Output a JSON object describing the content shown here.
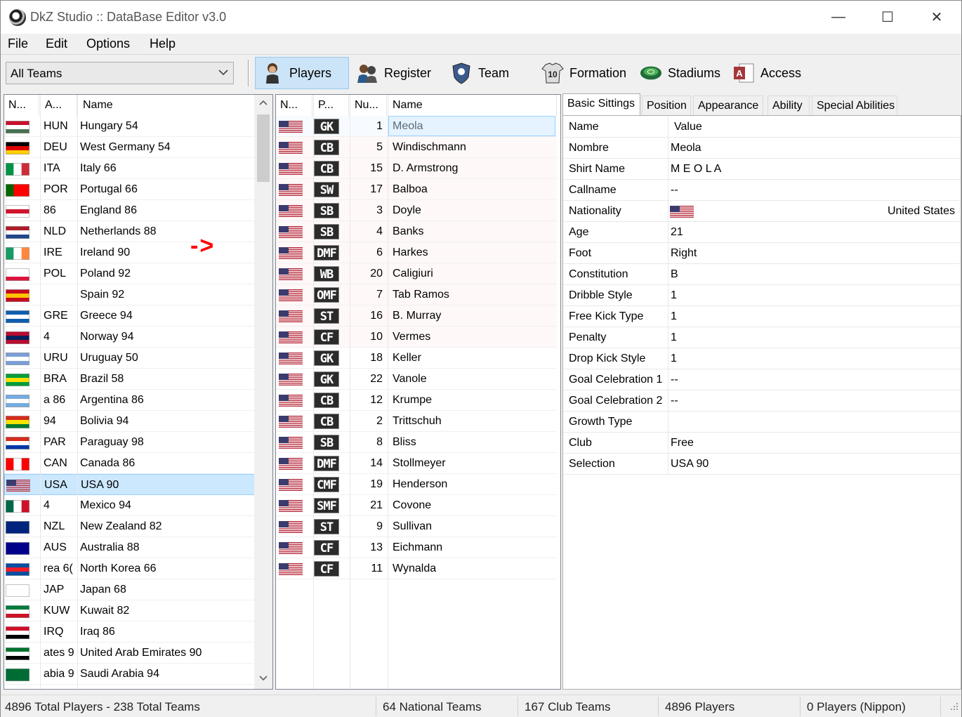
{
  "window": {
    "title": "DkZ Studio :: DataBase Editor v3.0",
    "minimize": "—",
    "maximize": "☐",
    "close": "✕"
  },
  "menu": [
    {
      "label": "File"
    },
    {
      "label": "Edit"
    },
    {
      "label": "Options"
    },
    {
      "label": "Help"
    }
  ],
  "toolbar": {
    "team_filter": "All Teams",
    "buttons": [
      {
        "label": "Players",
        "active": true
      },
      {
        "label": "Register"
      },
      {
        "label": "Team"
      },
      {
        "label": "Formation"
      },
      {
        "label": "Stadiums"
      },
      {
        "label": "Access"
      }
    ]
  },
  "teams": {
    "headers": [
      "N...",
      "A...",
      "Name"
    ],
    "selected_index": 17,
    "rows": [
      {
        "abbr": "HUN",
        "name": "Hungary 54",
        "flag": [
          "#c8102e",
          "#fff",
          "#477050"
        ]
      },
      {
        "abbr": "DEU",
        "name": "West Germany 54",
        "flag": [
          "#000",
          "#dd0000",
          "#ffce00"
        ]
      },
      {
        "abbr": "ITA",
        "name": "Italy 66",
        "flag": [
          "#009246",
          "#fff",
          "#ce2b37"
        ],
        "vertical": true
      },
      {
        "abbr": "POR",
        "name": "Portugal 66",
        "flag": [
          "#006600",
          "#ff0000",
          "#ff0000"
        ],
        "vertical": true
      },
      {
        "abbr": "86",
        "name": "England 86",
        "flag": [
          "#fff",
          "#cf142b",
          "#fff"
        ]
      },
      {
        "abbr": "NLD",
        "name": "Netherlands 88",
        "flag": [
          "#ae1c28",
          "#fff",
          "#21468b"
        ]
      },
      {
        "abbr": "IRE",
        "name": "Ireland 90",
        "flag": [
          "#169b62",
          "#fff",
          "#ff883e"
        ],
        "vertical": true
      },
      {
        "abbr": "POL",
        "name": "Poland 92",
        "flag": [
          "#fff",
          "#fff",
          "#dc143c"
        ]
      },
      {
        "abbr": "",
        "name": "Spain 92",
        "flag": [
          "#c60b1e",
          "#ffc400",
          "#c60b1e"
        ]
      },
      {
        "abbr": "GRE",
        "name": "Greece 94",
        "flag": [
          "#0d5eaf",
          "#fff",
          "#0d5eaf"
        ]
      },
      {
        "abbr": "4",
        "name": "Norway 94",
        "flag": [
          "#ba0c2f",
          "#00205b",
          "#ba0c2f"
        ]
      },
      {
        "abbr": "URU",
        "name": "Uruguay 50",
        "flag": [
          "#7b9fd6",
          "#fff",
          "#7b9fd6"
        ]
      },
      {
        "abbr": "BRA",
        "name": "Brazil 58",
        "flag": [
          "#009c3b",
          "#ffdf00",
          "#009c3b"
        ]
      },
      {
        "abbr": "a 86",
        "name": "Argentina 86",
        "flag": [
          "#74acdf",
          "#fff",
          "#74acdf"
        ]
      },
      {
        "abbr": "94",
        "name": "Bolivia 94",
        "flag": [
          "#d52b1e",
          "#f9e300",
          "#007934"
        ]
      },
      {
        "abbr": "PAR",
        "name": "Paraguay 98",
        "flag": [
          "#d52b1e",
          "#fff",
          "#0038a8"
        ]
      },
      {
        "abbr": "CAN",
        "name": "Canada 86",
        "flag": [
          "#ff0000",
          "#fff",
          "#ff0000"
        ],
        "vertical": true
      },
      {
        "abbr": "USA",
        "name": "USA 90",
        "flag": [
          "#b22234",
          "#fff",
          "#3c3b6e"
        ]
      },
      {
        "abbr": "4",
        "name": "Mexico 94",
        "flag": [
          "#006847",
          "#fff",
          "#ce1126"
        ],
        "vertical": true
      },
      {
        "abbr": "NZL",
        "name": "New Zealand 82",
        "flag": [
          "#00247d",
          "#00247d",
          "#00247d"
        ]
      },
      {
        "abbr": "AUS",
        "name": "Australia 88",
        "flag": [
          "#00008b",
          "#00008b",
          "#00008b"
        ]
      },
      {
        "abbr": "rea 6(",
        "name": "North Korea 66",
        "flag": [
          "#024fa2",
          "#ed1c27",
          "#024fa2"
        ]
      },
      {
        "abbr": "JAP",
        "name": "Japan 68",
        "flag": [
          "#fff",
          "#fff",
          "#fff"
        ]
      },
      {
        "abbr": "KUW",
        "name": "Kuwait 82",
        "flag": [
          "#007a3d",
          "#fff",
          "#ce1126"
        ]
      },
      {
        "abbr": "IRQ",
        "name": "Iraq 86",
        "flag": [
          "#ce1126",
          "#fff",
          "#000"
        ]
      },
      {
        "abbr": "ates 9",
        "name": "United Arab Emirates 90",
        "flag": [
          "#00732f",
          "#fff",
          "#000"
        ]
      },
      {
        "abbr": "abia 9",
        "name": "Saudi Arabia 94",
        "flag": [
          "#006c35",
          "#006c35",
          "#006c35"
        ]
      }
    ]
  },
  "annotation": "->",
  "players": {
    "headers": [
      "N...",
      "P...",
      "Nu...",
      "Name"
    ],
    "rows": [
      {
        "pos": "GK",
        "num": "1",
        "name": "Meola"
      },
      {
        "pos": "CB",
        "num": "5",
        "name": "Windischmann"
      },
      {
        "pos": "CB",
        "num": "15",
        "name": "D. Armstrong"
      },
      {
        "pos": "SW",
        "num": "17",
        "name": "Balboa"
      },
      {
        "pos": "SB",
        "num": "3",
        "name": "Doyle"
      },
      {
        "pos": "SB",
        "num": "4",
        "name": "Banks"
      },
      {
        "pos": "DMF",
        "num": "6",
        "name": "Harkes"
      },
      {
        "pos": "WB",
        "num": "20",
        "name": "Caligiuri"
      },
      {
        "pos": "OMF",
        "num": "7",
        "name": "Tab Ramos"
      },
      {
        "pos": "ST",
        "num": "16",
        "name": "B. Murray"
      },
      {
        "pos": "CF",
        "num": "10",
        "name": "Vermes"
      },
      {
        "pos": "GK",
        "num": "18",
        "name": "Keller"
      },
      {
        "pos": "GK",
        "num": "22",
        "name": "Vanole"
      },
      {
        "pos": "CB",
        "num": "12",
        "name": "Krumpe"
      },
      {
        "pos": "CB",
        "num": "2",
        "name": "Trittschuh"
      },
      {
        "pos": "SB",
        "num": "8",
        "name": "Bliss"
      },
      {
        "pos": "DMF",
        "num": "14",
        "name": "Stollmeyer"
      },
      {
        "pos": "CMF",
        "num": "19",
        "name": "Henderson"
      },
      {
        "pos": "SMF",
        "num": "21",
        "name": "Covone"
      },
      {
        "pos": "ST",
        "num": "9",
        "name": "Sullivan"
      },
      {
        "pos": "CF",
        "num": "13",
        "name": "Eichmann"
      },
      {
        "pos": "CF",
        "num": "11",
        "name": "Wynalda"
      }
    ]
  },
  "tabs": [
    "Basic Sittings",
    "Position",
    "Appearance",
    "Ability",
    "Special Abilities"
  ],
  "properties": {
    "header": {
      "name": "Name",
      "value": "Value"
    },
    "rows": [
      {
        "name": "Nombre",
        "value": "Meola"
      },
      {
        "name": "Shirt Name",
        "value": "M E O L A"
      },
      {
        "name": "Callname",
        "value": "--"
      },
      {
        "name": "Nationality",
        "value": "United States",
        "flag": true
      },
      {
        "name": "Age",
        "value": "21"
      },
      {
        "name": "Foot",
        "value": "Right"
      },
      {
        "name": "Constitution",
        "value": "B"
      },
      {
        "name": "Dribble Style",
        "value": "1"
      },
      {
        "name": "Free Kick Type",
        "value": "1"
      },
      {
        "name": "Penalty",
        "value": "1"
      },
      {
        "name": "Drop Kick Style",
        "value": "1"
      },
      {
        "name": "Goal Celebration 1",
        "value": "--"
      },
      {
        "name": "Goal Celebration 2",
        "value": "--"
      },
      {
        "name": "Growth Type",
        "value": ""
      },
      {
        "name": "Club",
        "value": "Free"
      },
      {
        "name": "Selection",
        "value": "USA 90"
      }
    ]
  },
  "status": {
    "totals": "4896 Total Players  -  238 Total Teams",
    "national": "64 National Teams",
    "club": "167 Club Teams",
    "players": "4896 Players",
    "nippon": "0 Players (Nippon)"
  },
  "colors": {
    "selection": "#cce8ff",
    "tab_active": "#ffffff",
    "annotation": "#ff0000"
  }
}
